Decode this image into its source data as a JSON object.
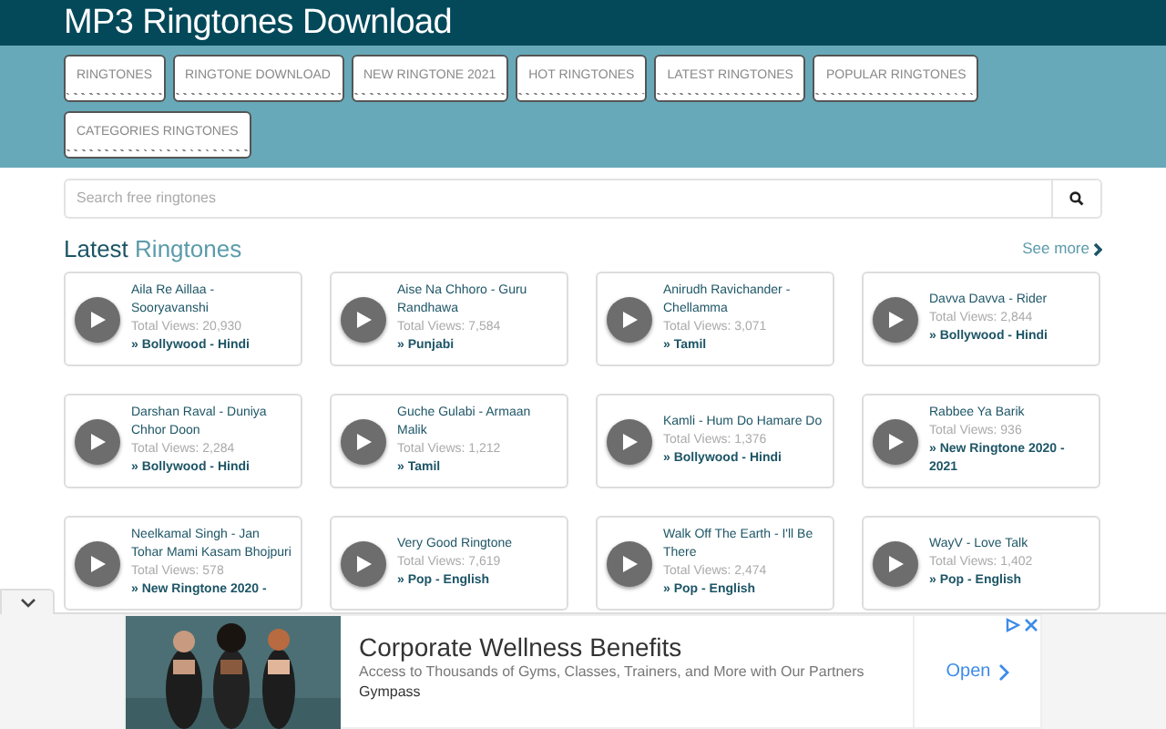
{
  "site_title": "MP3 Ringtones Download",
  "nav_buttons": [
    "RINGTONES",
    "RINGTONE DOWNLOAD",
    "NEW RINGTONE 2021",
    "HOT RINGTONES",
    "LATEST RINGTONES",
    "POPULAR RINGTONES",
    "CATEGORIES RINGTONES"
  ],
  "search": {
    "placeholder": "Search free ringtones"
  },
  "section": {
    "title_lead": "Latest",
    "title_rest": "Ringtones",
    "see_more": "See more"
  },
  "ringtones": [
    {
      "title": "Aila Re Aillaa - Sooryavanshi",
      "views": "Total Views: 20,930",
      "category": "» Bollywood - Hindi"
    },
    {
      "title": "Aise Na Chhoro - Guru Randhawa",
      "views": "Total Views: 7,584",
      "category": "» Punjabi"
    },
    {
      "title": "Anirudh Ravichander - Chellamma",
      "views": "Total Views: 3,071",
      "category": "» Tamil"
    },
    {
      "title": "Davva Davva - Rider",
      "views": "Total Views: 2,844",
      "category": "» Bollywood - Hindi"
    },
    {
      "title": "Darshan Raval - Duniya Chhor Doon",
      "views": "Total Views: 2,284",
      "category": "» Bollywood - Hindi"
    },
    {
      "title": "Guche Gulabi - Armaan Malik",
      "views": "Total Views: 1,212",
      "category": "» Tamil"
    },
    {
      "title": "Kamli - Hum Do Hamare Do",
      "views": "Total Views: 1,376",
      "category": "» Bollywood - Hindi"
    },
    {
      "title": "Rabbee Ya Barik",
      "views": "Total Views: 936",
      "category": "» New Ringtone 2020 - 2021"
    },
    {
      "title": "Neelkamal Singh - Jan Tohar Mami Kasam Bhojpuri",
      "views": "Total Views: 578",
      "category": "» New Ringtone 2020 -"
    },
    {
      "title": "Very Good Ringtone",
      "views": "Total Views: 7,619",
      "category": "» Pop - English"
    },
    {
      "title": "Walk Off The Earth - I'll Be There",
      "views": "Total Views: 2,474",
      "category": "» Pop - English"
    },
    {
      "title": "WayV - Love Talk",
      "views": "Total Views: 1,402",
      "category": "» Pop - English"
    }
  ],
  "ad": {
    "kind": "picture",
    "headline": "Corporate Wellness Benefits",
    "description": "Access to Thousands of Gyms, Classes, Trainers, and More with Our Partners",
    "advertiser": "Gympass",
    "button": "Open"
  }
}
